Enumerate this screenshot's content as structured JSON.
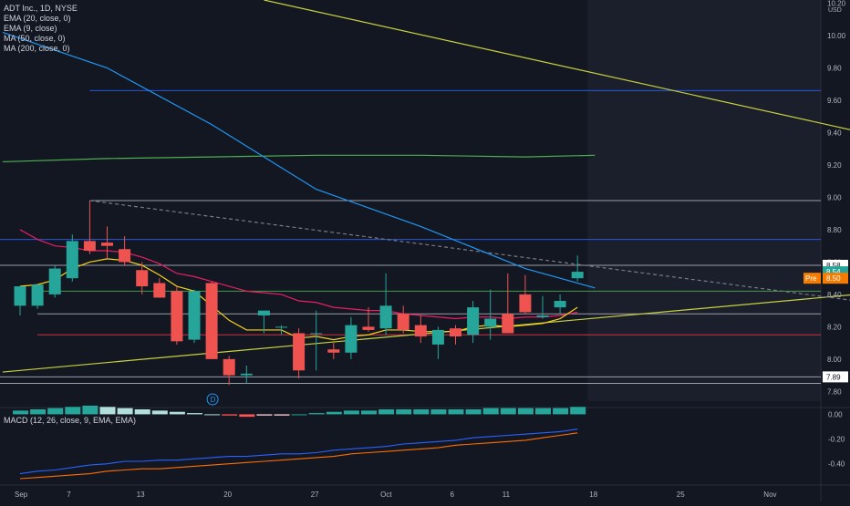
{
  "legend": {
    "symbol_line": "ADT Inc., 1D, NYSE",
    "ind1": "EMA (20, close, 0)",
    "ind2": "EMA (9, close)",
    "ind3": "MA (50, close, 0)",
    "ind4": "MA (200, close, 0)"
  },
  "macd_legend": "MACD (12, 26, close, 9, EMA, EMA)",
  "currency": "USD",
  "dividend_marker": "D",
  "colors": {
    "background": "#131722",
    "up": "#26a69a",
    "down": "#ef5350",
    "ema20": "#e91e63",
    "ema9": "#f7d21a",
    "ma50": "#2196f3",
    "ma200": "#4caf50",
    "trend_yellow": "#c6d23f",
    "level_line": "#b2b5be",
    "support_red": "#f23645",
    "hline_blue": "#2962ff",
    "pre_label": "#f57c00",
    "macd_line": "#2962ff",
    "signal_line": "#ff6d00"
  },
  "price_labels": [
    {
      "label": "8.58",
      "value": 8.58,
      "style": "white"
    },
    {
      "label": "8.54",
      "value": 8.54,
      "style": "teal"
    },
    {
      "label": "8.50",
      "value": 8.5,
      "style": "orange"
    },
    {
      "label": "7.89",
      "value": 7.89,
      "style": "white"
    }
  ],
  "pre_tag": "Pre",
  "chart_data": [
    {
      "type": "candlestick",
      "title": "ADT Inc., 1D, NYSE",
      "ylabel": "USD",
      "ylim": [
        7.74,
        10.22
      ],
      "y_ticks": [
        "7.80",
        "8.00",
        "8.20",
        "8.40",
        "8.60",
        "8.80",
        "9.00",
        "9.20",
        "9.40",
        "9.60",
        "9.80",
        "10.00",
        "10.20"
      ],
      "x_ticks": [
        "Sep",
        "7",
        "13",
        "20",
        "27",
        "Oct",
        "6",
        "11",
        "18",
        "25",
        "Nov"
      ],
      "x_tick_index": [
        0,
        3,
        7,
        12,
        17,
        21,
        25,
        28,
        33,
        38,
        43
      ],
      "grid": false,
      "candles": [
        {
          "o": 8.33,
          "h": 8.44,
          "l": 8.27,
          "c": 8.45
        },
        {
          "o": 8.33,
          "h": 8.46,
          "l": 8.31,
          "c": 8.46
        },
        {
          "o": 8.4,
          "h": 8.58,
          "l": 8.38,
          "c": 8.56
        },
        {
          "o": 8.5,
          "h": 8.77,
          "l": 8.48,
          "c": 8.73
        },
        {
          "o": 8.73,
          "h": 8.98,
          "l": 8.65,
          "c": 8.67
        },
        {
          "o": 8.72,
          "h": 8.82,
          "l": 8.62,
          "c": 8.7
        },
        {
          "o": 8.68,
          "h": 8.76,
          "l": 8.58,
          "c": 8.6
        },
        {
          "o": 8.55,
          "h": 8.6,
          "l": 8.4,
          "c": 8.45
        },
        {
          "o": 8.47,
          "h": 8.5,
          "l": 8.38,
          "c": 8.38
        },
        {
          "o": 8.42,
          "h": 8.45,
          "l": 8.09,
          "c": 8.11
        },
        {
          "o": 8.12,
          "h": 8.43,
          "l": 8.1,
          "c": 8.42
        },
        {
          "o": 8.47,
          "h": 8.48,
          "l": 8.02,
          "c": 8.0
        },
        {
          "o": 8.0,
          "h": 8.02,
          "l": 7.84,
          "c": 7.9
        },
        {
          "o": 7.9,
          "h": 7.96,
          "l": 7.85,
          "c": 7.91
        },
        {
          "o": 8.27,
          "h": 8.3,
          "l": 8.16,
          "c": 8.3
        },
        {
          "o": 8.2,
          "h": 8.21,
          "l": 8.15,
          "c": 8.2
        },
        {
          "o": 8.16,
          "h": 8.19,
          "l": 7.88,
          "c": 7.93
        },
        {
          "o": 8.16,
          "h": 8.3,
          "l": 7.93,
          "c": 8.16
        },
        {
          "o": 8.06,
          "h": 8.1,
          "l": 8.0,
          "c": 8.04
        },
        {
          "o": 8.04,
          "h": 8.26,
          "l": 8.0,
          "c": 8.21
        },
        {
          "o": 8.2,
          "h": 8.32,
          "l": 8.17,
          "c": 8.18
        },
        {
          "o": 8.19,
          "h": 8.53,
          "l": 8.15,
          "c": 8.33
        },
        {
          "o": 8.28,
          "h": 8.33,
          "l": 8.16,
          "c": 8.18
        },
        {
          "o": 8.21,
          "h": 8.27,
          "l": 8.1,
          "c": 8.14
        },
        {
          "o": 8.09,
          "h": 8.2,
          "l": 8.0,
          "c": 8.18
        },
        {
          "o": 8.19,
          "h": 8.21,
          "l": 8.09,
          "c": 8.14
        },
        {
          "o": 8.15,
          "h": 8.36,
          "l": 8.1,
          "c": 8.32
        },
        {
          "o": 8.2,
          "h": 8.43,
          "l": 8.12,
          "c": 8.25
        },
        {
          "o": 8.28,
          "h": 8.53,
          "l": 8.16,
          "c": 8.16
        },
        {
          "o": 8.4,
          "h": 8.52,
          "l": 8.28,
          "c": 8.29
        },
        {
          "o": 8.26,
          "h": 8.39,
          "l": 8.25,
          "c": 8.27
        },
        {
          "o": 8.32,
          "h": 8.4,
          "l": 8.28,
          "c": 8.36
        },
        {
          "o": 8.5,
          "h": 8.64,
          "l": 8.48,
          "c": 8.54
        }
      ],
      "ema9": [
        8.45,
        8.46,
        8.49,
        8.56,
        8.6,
        8.62,
        8.61,
        8.58,
        8.52,
        8.45,
        8.42,
        8.33,
        8.24,
        8.18,
        8.18,
        8.18,
        8.13,
        8.14,
        8.12,
        8.14,
        8.15,
        8.18,
        8.18,
        8.17,
        8.17,
        8.17,
        8.2,
        8.21,
        8.2,
        8.21,
        8.22,
        8.25,
        8.32
      ],
      "ema20": [
        8.8,
        8.74,
        8.7,
        8.69,
        8.67,
        8.67,
        8.66,
        8.63,
        8.59,
        8.53,
        8.51,
        8.48,
        8.45,
        8.42,
        8.41,
        8.4,
        8.36,
        8.35,
        8.32,
        8.31,
        8.3,
        8.3,
        8.28,
        8.27,
        8.26,
        8.25,
        8.26,
        8.26,
        8.25,
        8.26,
        8.26,
        8.27,
        8.29
      ],
      "ma50_points": [
        [
          -1,
          10.02
        ],
        [
          5,
          9.8
        ],
        [
          11,
          9.45
        ],
        [
          17,
          9.05
        ],
        [
          23,
          8.82
        ],
        [
          29,
          8.56
        ],
        [
          33,
          8.44
        ]
      ],
      "ma200_points": [
        [
          -1,
          9.22
        ],
        [
          5,
          9.24
        ],
        [
          11,
          9.25
        ],
        [
          17,
          9.26
        ],
        [
          23,
          9.26
        ],
        [
          29,
          9.25
        ],
        [
          33,
          9.26
        ]
      ],
      "trend_line": {
        "from": [
          -1,
          7.92
        ],
        "to": [
          48,
          8.4
        ]
      },
      "upper_trend": {
        "from": [
          14,
          10.22
        ],
        "to": [
          48,
          9.41
        ]
      },
      "dashed_line": {
        "from": [
          4,
          8.98
        ],
        "to": [
          48,
          8.36
        ]
      },
      "horizontal_levels": [
        {
          "value": 9.66,
          "from": 4,
          "color": "hline_blue"
        },
        {
          "value": 8.98,
          "from": 4,
          "color": "level_line"
        },
        {
          "value": 8.74,
          "from": 0,
          "color": "hline_blue"
        },
        {
          "value": 8.58,
          "from": 0,
          "color": "level_line"
        },
        {
          "value": 8.42,
          "from": 1,
          "color": "ma200"
        },
        {
          "value": 8.28,
          "from": 1,
          "color": "level_line"
        },
        {
          "value": 8.15,
          "from": 1,
          "color": "support_red"
        },
        {
          "value": 7.89,
          "from": 0,
          "color": "level_line"
        },
        {
          "value": 7.85,
          "from": 0,
          "color": "level_line"
        }
      ]
    },
    {
      "type": "histogram+line",
      "title": "MACD (12, 26, close, 9, EMA, EMA)",
      "ylim": [
        -0.52,
        0.04
      ],
      "y_ticks": [
        "0.00",
        "-0.20",
        "-0.40"
      ],
      "histogram": [
        0.03,
        0.04,
        0.05,
        0.06,
        0.07,
        0.06,
        0.05,
        0.04,
        0.03,
        0.02,
        0.01,
        0.0,
        -0.01,
        -0.02,
        -0.01,
        -0.01,
        0.0,
        0.01,
        0.02,
        0.03,
        0.03,
        0.04,
        0.04,
        0.04,
        0.04,
        0.04,
        0.04,
        0.05,
        0.05,
        0.05,
        0.05,
        0.05,
        0.06
      ],
      "macd_line": [
        -0.48,
        -0.46,
        -0.45,
        -0.43,
        -0.41,
        -0.4,
        -0.38,
        -0.38,
        -0.37,
        -0.37,
        -0.36,
        -0.35,
        -0.34,
        -0.34,
        -0.33,
        -0.32,
        -0.32,
        -0.31,
        -0.29,
        -0.28,
        -0.27,
        -0.26,
        -0.24,
        -0.23,
        -0.22,
        -0.21,
        -0.19,
        -0.18,
        -0.17,
        -0.16,
        -0.15,
        -0.14,
        -0.12
      ],
      "signal_line": [
        -0.52,
        -0.51,
        -0.5,
        -0.49,
        -0.48,
        -0.46,
        -0.45,
        -0.44,
        -0.44,
        -0.43,
        -0.42,
        -0.41,
        -0.4,
        -0.39,
        -0.38,
        -0.37,
        -0.36,
        -0.35,
        -0.34,
        -0.32,
        -0.31,
        -0.3,
        -0.29,
        -0.28,
        -0.27,
        -0.25,
        -0.24,
        -0.23,
        -0.22,
        -0.21,
        -0.19,
        -0.17,
        -0.15
      ]
    }
  ]
}
